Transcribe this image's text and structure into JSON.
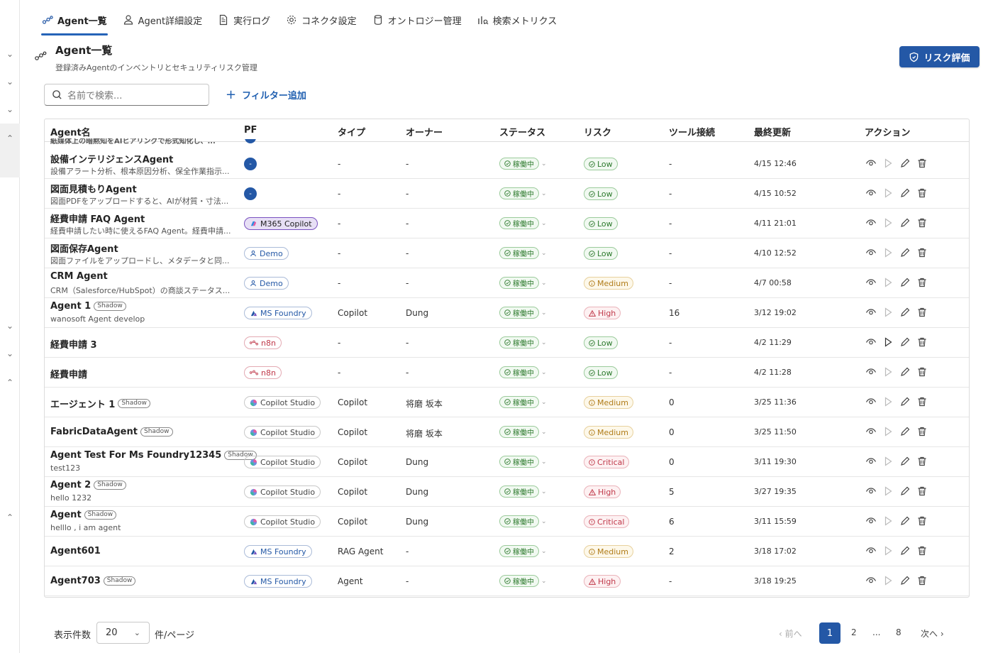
{
  "tabs": [
    {
      "label": "Agent一覧",
      "icon": "agents-icon"
    },
    {
      "label": "Agent詳細設定",
      "icon": "person-icon"
    },
    {
      "label": "実行ログ",
      "icon": "document-icon"
    },
    {
      "label": "コネクタ設定",
      "icon": "gear-icon"
    },
    {
      "label": "オントロジー管理",
      "icon": "database-icon"
    },
    {
      "label": "検索メトリクス",
      "icon": "metrics-icon"
    }
  ],
  "header": {
    "title": "Agent一覧",
    "subtitle": "登録済みAgentのインベントリとセキュリティリスク管理"
  },
  "risk_button": "リスク評価",
  "search": {
    "placeholder": "名前で検索..."
  },
  "filter_label": "フィルター追加",
  "columns": [
    "Agent名",
    "PF",
    "タイプ",
    "オーナー",
    "ステータス",
    "リスク",
    "ツール接続",
    "最終更新",
    "アクション"
  ],
  "clipped_top_text": "紙媒体上の暗黙知をAIヒアリングで形式知化し、...",
  "shadow_label": "Shadow",
  "rows": [
    {
      "name": "設備インテリジェンスAgent",
      "shadow": false,
      "desc": "設備アラート分析、根本原因分析、保全作業指示...",
      "pf": "-",
      "pf_kind": "dot",
      "type": "-",
      "owner": "-",
      "status": "稼働中",
      "risk": "Low",
      "tools": "-",
      "updated": "4/15 12:46"
    },
    {
      "name": "図面見積もりAgent",
      "shadow": false,
      "desc": "図面PDFをアップロードすると、AIが材質・寸法...",
      "pf": "-",
      "pf_kind": "dot",
      "type": "-",
      "owner": "-",
      "status": "稼働中",
      "risk": "Low",
      "tools": "-",
      "updated": "4/15 10:52"
    },
    {
      "name": "経費申請 FAQ Agent",
      "shadow": false,
      "desc": "経費申請したい時に使えるFAQ Agent。経費申請...",
      "pf": "M365 Copilot",
      "pf_kind": "m365",
      "type": "-",
      "owner": "-",
      "status": "稼働中",
      "risk": "Low",
      "tools": "-",
      "updated": "4/11 21:01"
    },
    {
      "name": "図面保存Agent",
      "shadow": false,
      "desc": "図面ファイルをアップロードし、メタデータと同...",
      "pf": "Demo",
      "pf_kind": "demo",
      "type": "-",
      "owner": "-",
      "status": "稼働中",
      "risk": "Low",
      "tools": "-",
      "updated": "4/10 12:52"
    },
    {
      "name": "CRM Agent",
      "shadow": false,
      "desc": "CRM（Salesforce/HubSpot）の商談ステータス...",
      "pf": "Demo",
      "pf_kind": "demo",
      "type": "-",
      "owner": "-",
      "status": "稼働中",
      "risk": "Medium",
      "tools": "-",
      "updated": "4/7 00:58"
    },
    {
      "name": "Agent 1",
      "shadow": true,
      "desc": "wanosoft Agent develop",
      "pf": "MS Foundry",
      "pf_kind": "foundry",
      "type": "Copilot",
      "owner": "Dung",
      "status": "稼働中",
      "risk": "High",
      "tools": "16",
      "updated": "3/12 19:02"
    },
    {
      "name": "経費申請 3",
      "shadow": false,
      "desc": "",
      "pf": "n8n",
      "pf_kind": "n8n",
      "type": "-",
      "owner": "-",
      "status": "稼働中",
      "risk": "Low",
      "tools": "-",
      "updated": "4/2 11:29"
    },
    {
      "name": "経費申請",
      "shadow": false,
      "desc": "",
      "pf": "n8n",
      "pf_kind": "n8n",
      "type": "-",
      "owner": "-",
      "status": "稼働中",
      "risk": "Low",
      "tools": "-",
      "updated": "4/2 11:28"
    },
    {
      "name": "エージェント 1",
      "shadow": true,
      "desc": "",
      "pf": "Copilot Studio",
      "pf_kind": "studio",
      "type": "Copilot",
      "owner": "将磨 坂本",
      "status": "稼働中",
      "risk": "Medium",
      "tools": "0",
      "updated": "3/25 11:36"
    },
    {
      "name": "FabricDataAgent",
      "shadow": true,
      "desc": "",
      "pf": "Copilot Studio",
      "pf_kind": "studio",
      "type": "Copilot",
      "owner": "将磨 坂本",
      "status": "稼働中",
      "risk": "Medium",
      "tools": "0",
      "updated": "3/25 11:50"
    },
    {
      "name": "Agent Test For Ms Foundry12345",
      "shadow": true,
      "desc": "test123",
      "pf": "Copilot Studio",
      "pf_kind": "studio",
      "type": "Copilot",
      "owner": "Dung",
      "status": "稼働中",
      "risk": "Critical",
      "tools": "0",
      "updated": "3/11 19:30"
    },
    {
      "name": "Agent 2",
      "shadow": true,
      "desc": "hello 1232",
      "pf": "Copilot Studio",
      "pf_kind": "studio",
      "type": "Copilot",
      "owner": "Dung",
      "status": "稼働中",
      "risk": "High",
      "tools": "5",
      "updated": "3/27 19:35"
    },
    {
      "name": "Agent",
      "shadow": true,
      "desc": "helllo , i am agent",
      "pf": "Copilot Studio",
      "pf_kind": "studio",
      "type": "Copilot",
      "owner": "Dung",
      "status": "稼働中",
      "risk": "Critical",
      "tools": "6",
      "updated": "3/11 15:59"
    },
    {
      "name": "Agent601",
      "shadow": false,
      "desc": "",
      "pf": "MS Foundry",
      "pf_kind": "foundry",
      "type": "RAG Agent",
      "owner": "-",
      "status": "稼働中",
      "risk": "Medium",
      "tools": "2",
      "updated": "3/18 17:02"
    },
    {
      "name": "Agent703",
      "shadow": true,
      "desc": "",
      "pf": "MS Foundry",
      "pf_kind": "foundry",
      "type": "Agent",
      "owner": "-",
      "status": "稼働中",
      "risk": "High",
      "tools": "-",
      "updated": "3/18 19:25"
    }
  ],
  "pagination": {
    "page_size_label": "表示件数",
    "page_size": "20",
    "per_page_label": "件/ページ",
    "prev": "前へ",
    "next": "次へ",
    "pages": [
      "1",
      "2",
      "...",
      "8"
    ],
    "current": "1"
  },
  "colors": {
    "accent": "#2458a6",
    "ok": "#2d7a2d",
    "warn": "#b07b17",
    "danger": "#c0394a"
  }
}
